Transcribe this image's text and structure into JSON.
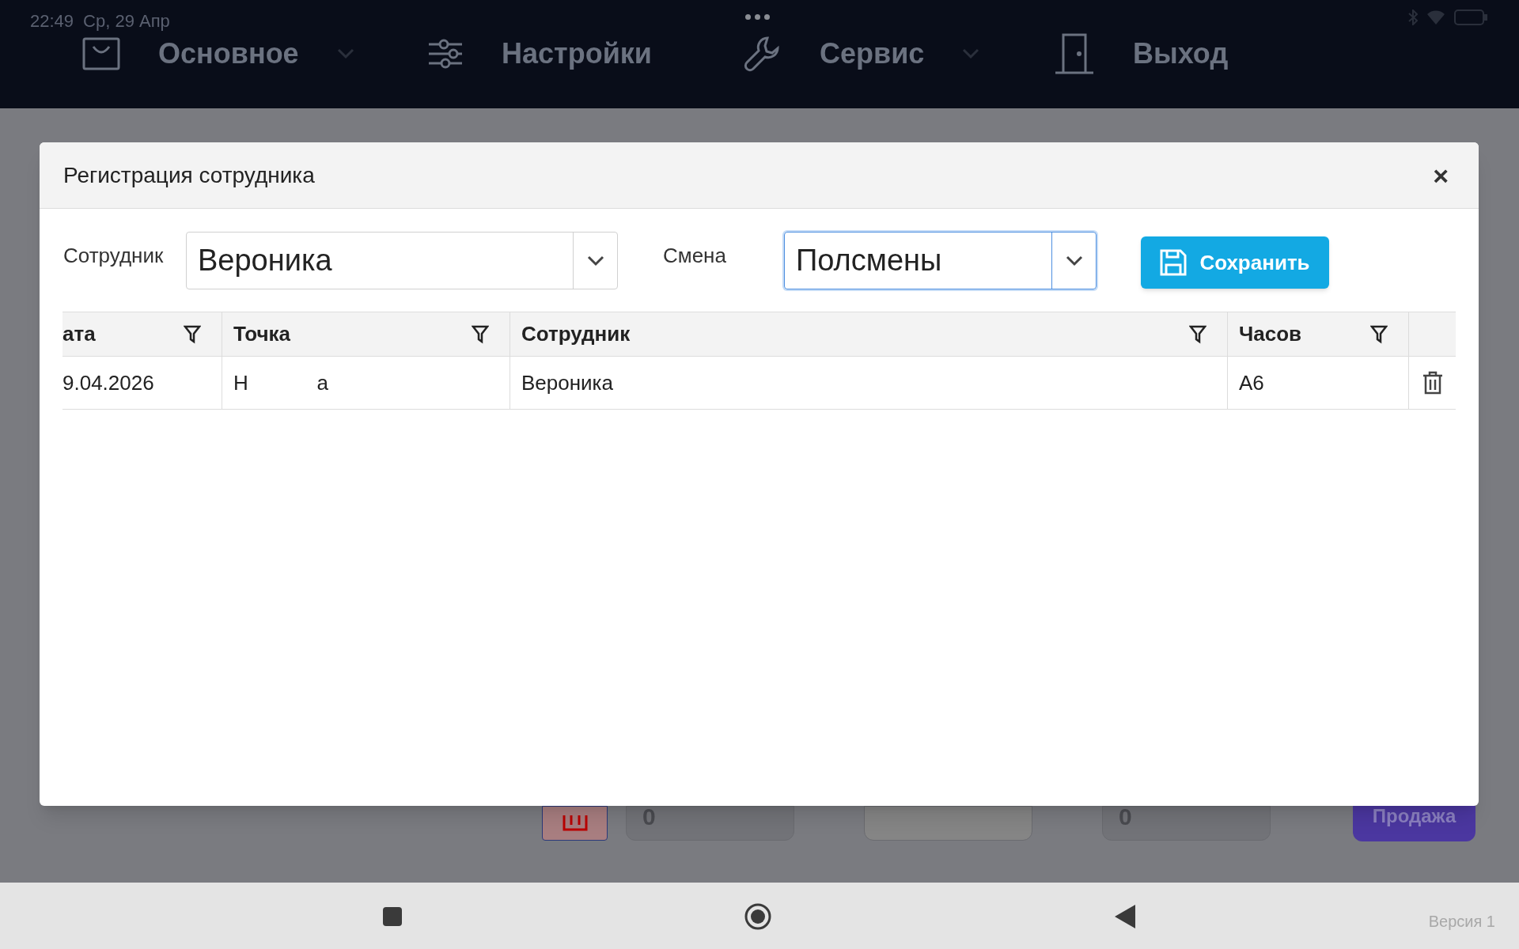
{
  "status_bar": {
    "time": "22:49",
    "date": "Ср, 29 Апр"
  },
  "nav": [
    {
      "label": "Основное",
      "dropdown": true
    },
    {
      "label": "Настройки",
      "dropdown": false
    },
    {
      "label": "Сервис",
      "dropdown": true
    },
    {
      "label": "Выход",
      "dropdown": false
    }
  ],
  "background": {
    "fields": [
      {
        "kind": "number",
        "text": "0"
      },
      {
        "kind": "blank"
      },
      {
        "kind": "number",
        "text": "0"
      }
    ],
    "sale_button": "Продажа"
  },
  "dialog": {
    "title": "Регистрация сотрудника",
    "close": "×",
    "employee": {
      "label": "Сотрудник",
      "value": "Вероника",
      "focused": false
    },
    "shift": {
      "label": "Смена",
      "value": "Полсмены",
      "focused": true
    },
    "save_button": "Сохранить",
    "table": {
      "columns": [
        {
          "label": "ата",
          "filter": true
        },
        {
          "label": "Точка",
          "filter": true
        },
        {
          "label": "Сотрудник",
          "filter": true
        },
        {
          "label": "Часов",
          "filter": true
        }
      ],
      "rows": [
        {
          "cells": [
            "9.04.2026",
            "Н            а",
            "Вероника",
            "А6"
          ]
        }
      ]
    }
  },
  "android_nav": {
    "version": "Версия 1"
  }
}
